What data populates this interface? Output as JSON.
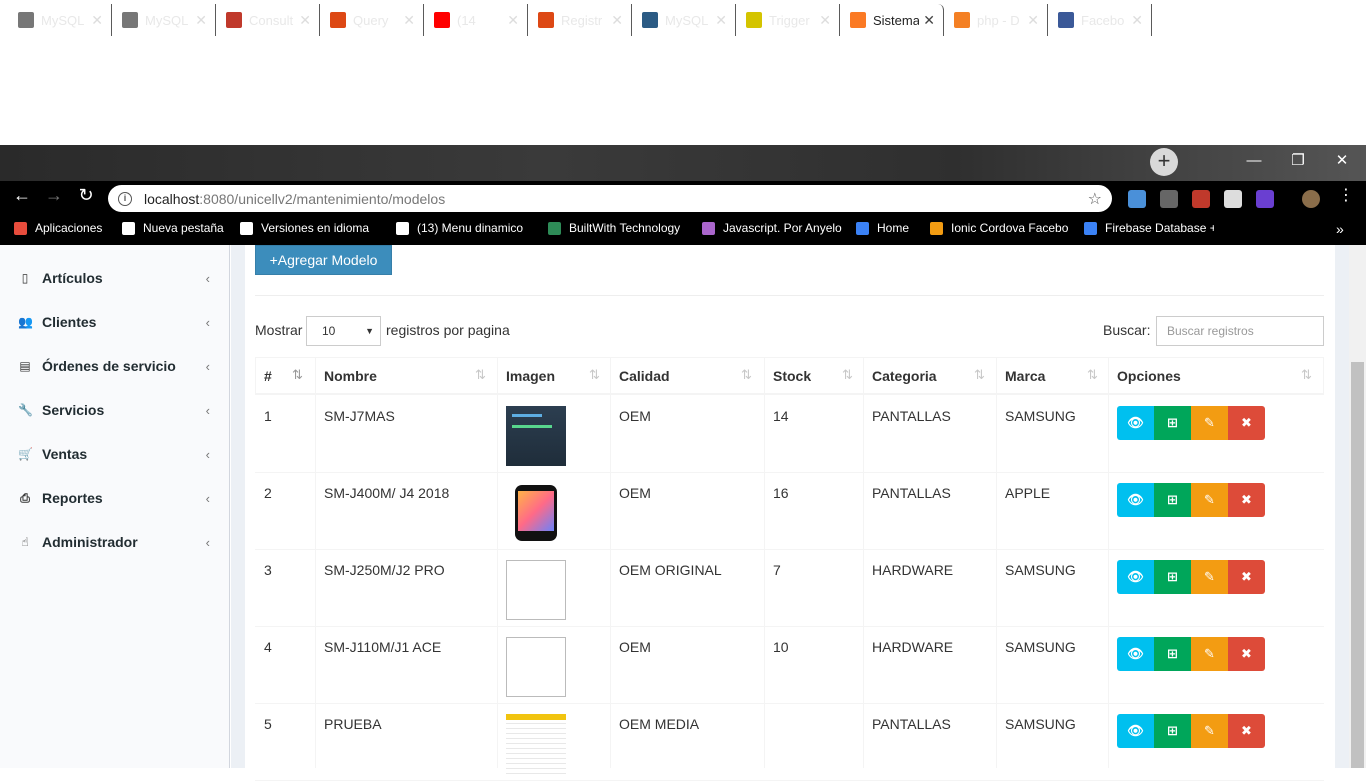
{
  "browser": {
    "tabs": [
      {
        "title": "MySQL",
        "icon": "doc-icon",
        "color": "#777777"
      },
      {
        "title": "MySQL",
        "icon": "doc-icon",
        "color": "#777777"
      },
      {
        "title": "Consult",
        "icon": "acrobat-icon",
        "color": "#c0392b"
      },
      {
        "title": "Query",
        "icon": "codeigniter-icon",
        "color": "#dd4814"
      },
      {
        "title": "(14",
        "icon": "youtube-icon",
        "color": "#ff0000"
      },
      {
        "title": "Registr",
        "icon": "codeigniter-icon",
        "color": "#dd4814"
      },
      {
        "title": "MySQL",
        "icon": "mysql-icon",
        "color": "#2b5b84"
      },
      {
        "title": "Trigger",
        "icon": "eye-icon",
        "color": "#d4c400"
      },
      {
        "title": "Sistema",
        "icon": "xampp-icon",
        "color": "#fb7a24"
      },
      {
        "title": "php - D",
        "icon": "stackoverflow-icon",
        "color": "#f48024"
      },
      {
        "title": "Facebo",
        "icon": "facebook-icon",
        "color": "#3b5998"
      }
    ],
    "url_host": "localhost",
    "url_path": ":8080/unicellv2/mantenimiento/modelos",
    "bookmarks": [
      {
        "label": "Aplicaciones",
        "color": "#e74c3c"
      },
      {
        "label": "Nueva pestaña",
        "color": "#ffffff"
      },
      {
        "label": "Versiones en idioma",
        "color": "#ffffff"
      },
      {
        "label": "(13) Menu dinamico",
        "color": "#ffffff"
      },
      {
        "label": "BuiltWith Technology",
        "color": "#2e8b57"
      },
      {
        "label": "Javascript. Por Anyelo",
        "color": "#aa66cc"
      },
      {
        "label": "Home",
        "color": "#3b82f6"
      },
      {
        "label": "Ionic Cordova Facebo",
        "color": "#f39c12"
      },
      {
        "label": "Firebase Database +",
        "color": "#3b82f6"
      }
    ],
    "more_label": "»"
  },
  "sidebar": {
    "items": [
      {
        "label": "Artículos",
        "icon": "tablet-icon"
      },
      {
        "label": "Clientes",
        "icon": "users-icon"
      },
      {
        "label": "Órdenes de servicio",
        "icon": "file-icon"
      },
      {
        "label": "Servicios",
        "icon": "wrench-icon"
      },
      {
        "label": "Ventas",
        "icon": "cart-icon"
      },
      {
        "label": "Reportes",
        "icon": "print-icon"
      },
      {
        "label": "Administrador",
        "icon": "hand-icon"
      }
    ]
  },
  "main": {
    "add_button": "+Agregar Modelo",
    "show_label": "Mostrar",
    "page_size": "10",
    "per_page_label": "registros por pagina",
    "search_label": "Buscar:",
    "search_placeholder": "Buscar registros",
    "columns": [
      "#",
      "Nombre",
      "Imagen",
      "Calidad",
      "Stock",
      "Categoria",
      "Marca",
      "Opciones"
    ],
    "rows": [
      {
        "num": "1",
        "nombre": "SM-J7MAS",
        "imagen": "code-screenshot",
        "calidad": "OEM",
        "stock": "14",
        "categoria": "PANTALLAS",
        "marca": "SAMSUNG"
      },
      {
        "num": "2",
        "nombre": "SM-J400M/ J4 2018",
        "imagen": "phone",
        "calidad": "OEM",
        "stock": "16",
        "categoria": "PANTALLAS",
        "marca": "APPLE"
      },
      {
        "num": "3",
        "nombre": "SM-J250M/J2 PRO",
        "imagen": "broken",
        "calidad": "OEM ORIGINAL",
        "stock": "7",
        "categoria": "HARDWARE",
        "marca": "SAMSUNG"
      },
      {
        "num": "4",
        "nombre": "SM-J110M/J1 ACE",
        "imagen": "broken",
        "calidad": "OEM",
        "stock": "10",
        "categoria": "HARDWARE",
        "marca": "SAMSUNG"
      },
      {
        "num": "5",
        "nombre": "PRUEBA",
        "imagen": "spreadsheet",
        "calidad": "OEM MEDIA",
        "stock": "",
        "categoria": "PANTALLAS",
        "marca": "SAMSUNG"
      }
    ]
  },
  "colors": {
    "primary": "#3c8dbc",
    "info": "#00c0ef",
    "success": "#00a65a",
    "warning": "#f39c12",
    "danger": "#dd4b39"
  }
}
